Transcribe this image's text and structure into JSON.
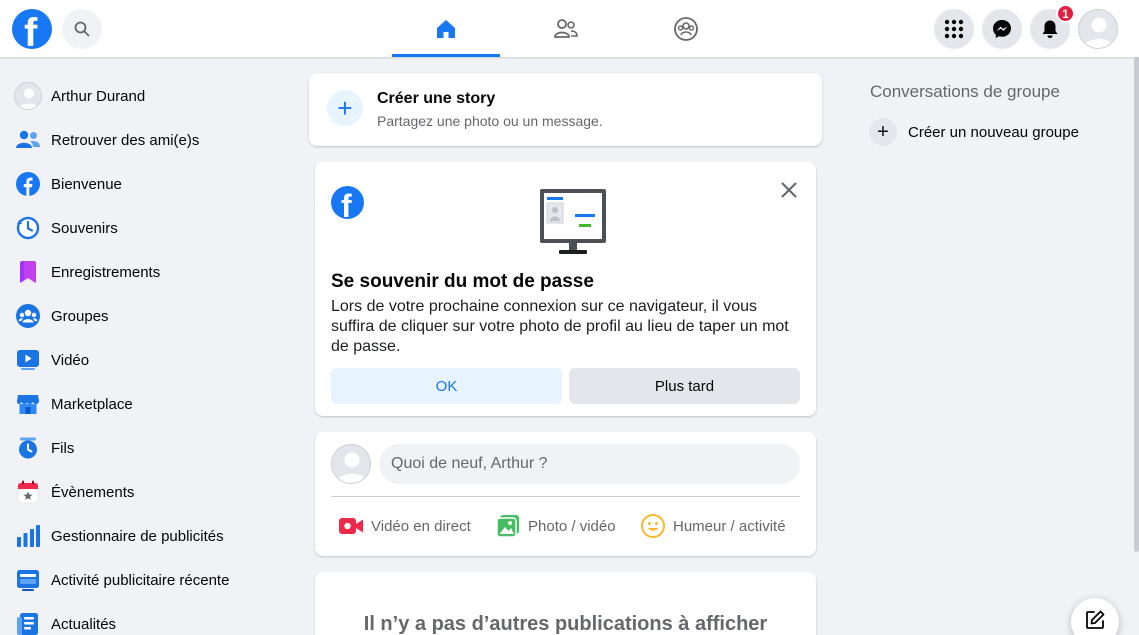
{
  "colors": {
    "brand": "#1877f2",
    "page_bg": "#f0f2f5",
    "badge": "#e41e3f"
  },
  "header": {
    "logo_letter": "f",
    "notification_count": "1",
    "icons": [
      "facebook-logo",
      "search-icon",
      "home-icon",
      "friends-icon",
      "groups-icon",
      "menu-grid-icon",
      "messenger-icon",
      "bell-icon",
      "avatar"
    ]
  },
  "sidebar": {
    "items": [
      {
        "label": "Arthur Durand",
        "icon": "profile-avatar"
      },
      {
        "label": "Retrouver des ami(e)s",
        "icon": "friends-icon"
      },
      {
        "label": "Bienvenue",
        "icon": "facebook-icon"
      },
      {
        "label": "Souvenirs",
        "icon": "clock-icon"
      },
      {
        "label": "Enregistrements",
        "icon": "bookmark-icon"
      },
      {
        "label": "Groupes",
        "icon": "groups-icon"
      },
      {
        "label": "Vidéo",
        "icon": "video-icon"
      },
      {
        "label": "Marketplace",
        "icon": "shop-icon"
      },
      {
        "label": "Fils",
        "icon": "feeds-icon"
      },
      {
        "label": "Évènements",
        "icon": "calendar-star-icon"
      },
      {
        "label": "Gestionnaire de publicités",
        "icon": "bar-chart-icon"
      },
      {
        "label": "Activité publicitaire récente",
        "icon": "ad-activity-icon"
      },
      {
        "label": "Actualités",
        "icon": "news-icon"
      }
    ]
  },
  "story": {
    "title": "Créer une story",
    "subtitle": "Partagez une photo ou un message."
  },
  "password_prompt": {
    "title": "Se souvenir du mot de passe",
    "text": "Lors de votre prochaine connexion sur ce navigateur, il vous suffira de cliquer sur votre photo de profil au lieu de taper un mot de passe.",
    "ok_label": "OK",
    "later_label": "Plus tard"
  },
  "composer": {
    "placeholder": "Quoi de neuf, Arthur ?",
    "live_label": "Vidéo en direct",
    "photo_label": "Photo / vidéo",
    "mood_label": "Humeur / activité"
  },
  "feed": {
    "empty_text": "Il n’y a pas d’autres publications à afficher"
  },
  "right": {
    "group_conversations_title": "Conversations de groupe",
    "new_group_label": "Créer un nouveau groupe"
  }
}
